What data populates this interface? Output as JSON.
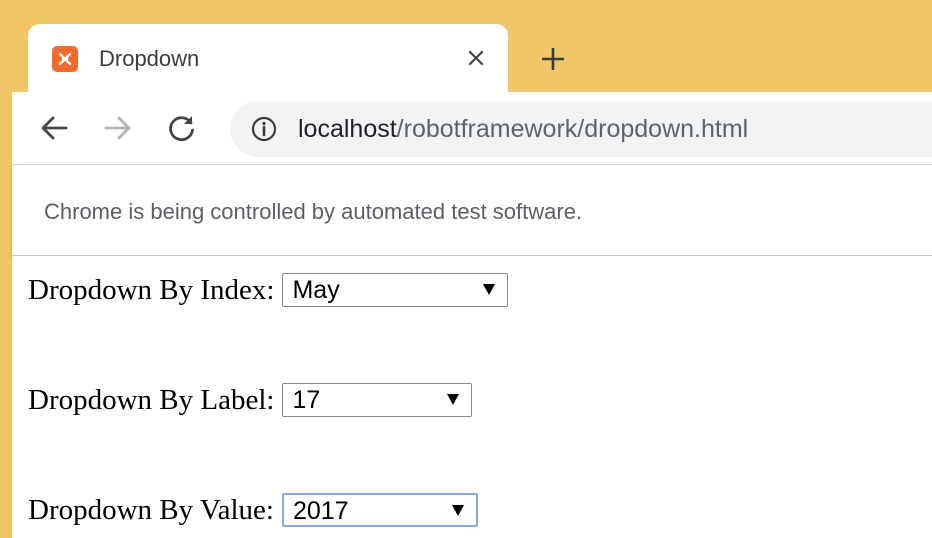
{
  "tab": {
    "title": "Dropdown",
    "favicon_icon": "xampp-icon",
    "close_icon": "close-icon",
    "new_tab_icon": "plus-icon"
  },
  "toolbar": {
    "back_icon": "arrow-left-icon",
    "forward_icon": "arrow-right-icon",
    "reload_icon": "reload-icon",
    "info_icon": "info-icon",
    "url_host": "localhost",
    "url_path": "/robotframework/dropdown.html"
  },
  "infobar": {
    "message": "Chrome is being controlled by automated test software."
  },
  "page": {
    "dropdowns": [
      {
        "label": "Dropdown By Index:",
        "value": "May"
      },
      {
        "label": "Dropdown By Label:",
        "value": "17"
      },
      {
        "label": "Dropdown By Value:",
        "value": "2017"
      }
    ]
  },
  "colors": {
    "tabstrip": "#f0c668",
    "favicon": "#f26b2c",
    "omnibox": "#f1f3f4",
    "focus_ring": "#84a8e2"
  }
}
